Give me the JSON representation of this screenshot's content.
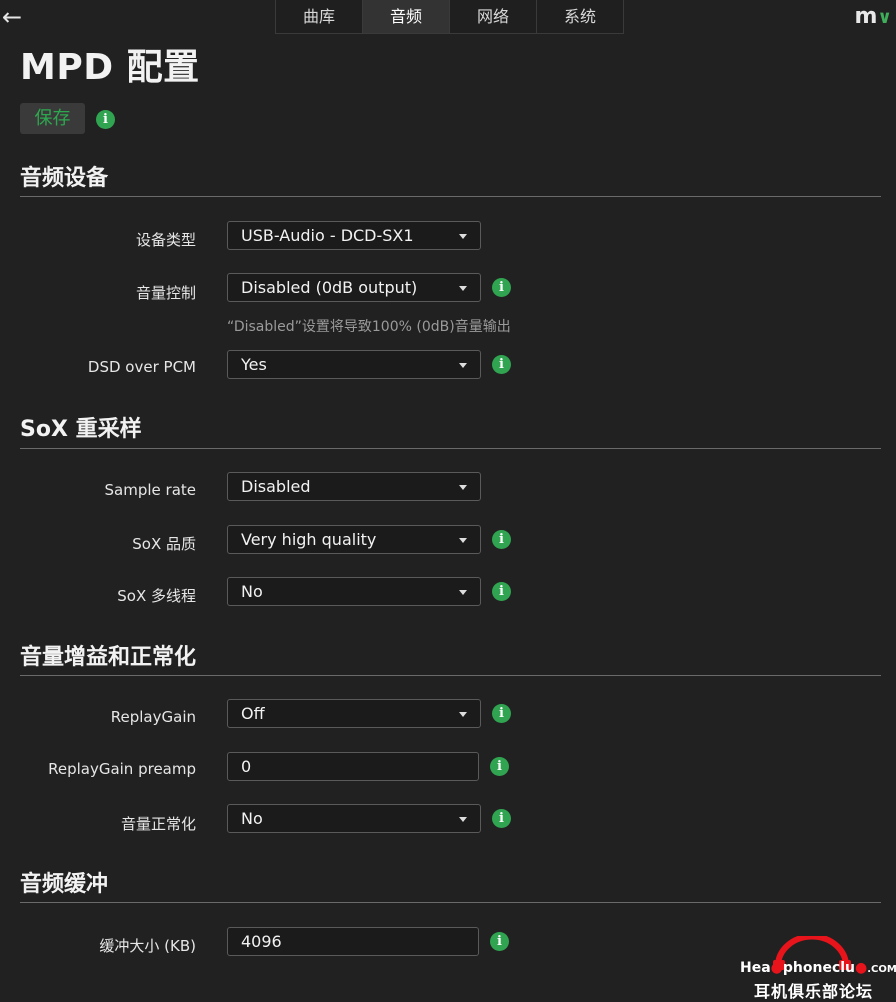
{
  "header": {
    "back_icon": "arrow-left-icon",
    "tabs": [
      {
        "label": "曲库",
        "active": false
      },
      {
        "label": "音频",
        "active": true
      },
      {
        "label": "网络",
        "active": false
      },
      {
        "label": "系统",
        "active": false
      }
    ],
    "menu_logo": "m",
    "menu_icon": "chevron-down-icon"
  },
  "page": {
    "title": "MPD 配置",
    "save_label": "保存"
  },
  "sections": {
    "audio_device": {
      "heading": "音频设备",
      "device_type_label": "设备类型",
      "device_type_value": "USB-Audio - DCD-SX1",
      "volume_control_label": "音量控制",
      "volume_control_value": "Disabled (0dB output)",
      "volume_hint": "“Disabled”设置将导致100% (0dB)音量输出",
      "dsd_label": "DSD over PCM",
      "dsd_value": "Yes"
    },
    "sox": {
      "heading": "SoX 重采样",
      "sample_rate_label": "Sample rate",
      "sample_rate_value": "Disabled",
      "quality_label": "SoX 品质",
      "quality_value": "Very high quality",
      "multithread_label": "SoX 多线程",
      "multithread_value": "No"
    },
    "gain": {
      "heading": "音量增益和正常化",
      "replaygain_label": "ReplayGain",
      "replaygain_value": "Off",
      "preamp_label": "ReplayGain preamp",
      "preamp_value": "0",
      "normalize_label": "音量正常化",
      "normalize_value": "No"
    },
    "buffer": {
      "heading": "音频缓冲",
      "size_label": "缓冲大小 (KB)",
      "size_value": "4096"
    }
  },
  "watermark": {
    "line1_a": "Hea",
    "line1_b": "phoneclu",
    "line1_c": ".COM",
    "line2": "耳机俱乐部论坛"
  },
  "colors": {
    "background": "#212121",
    "accent_green": "#30a451",
    "watermark_red": "#e8141c"
  }
}
